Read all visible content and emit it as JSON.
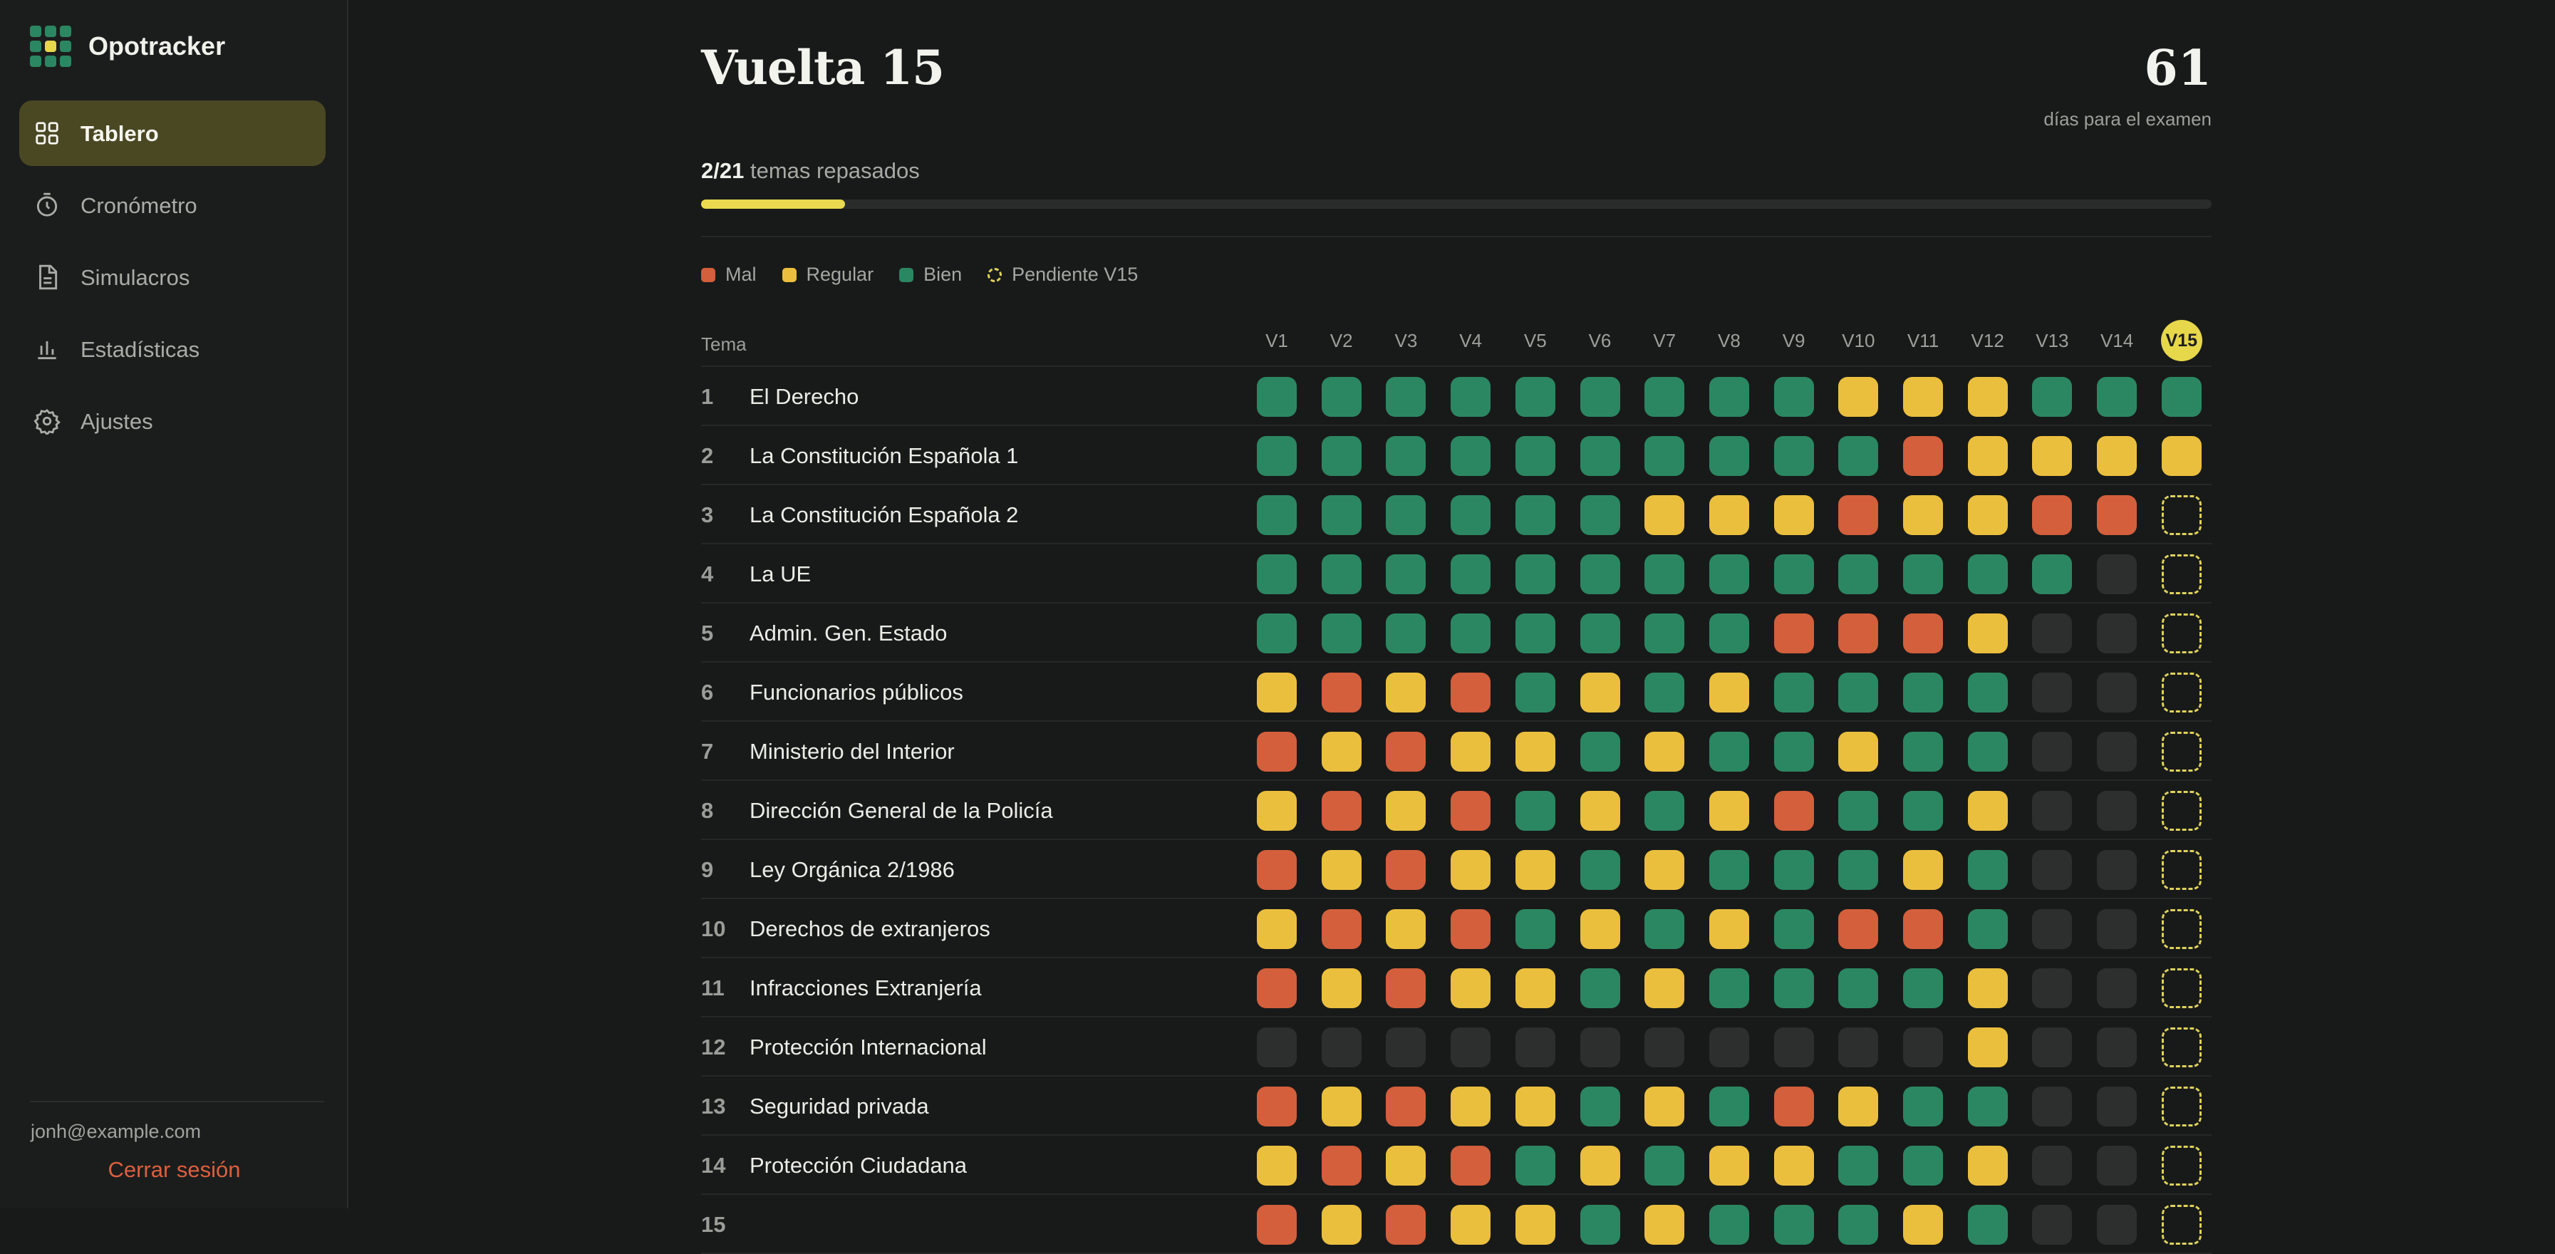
{
  "brand": {
    "name": "Opotracker"
  },
  "nav": [
    {
      "label": "Tablero",
      "icon": "dashboard-icon",
      "active": true
    },
    {
      "label": "Cronómetro",
      "icon": "timer-icon",
      "active": false
    },
    {
      "label": "Simulacros",
      "icon": "document-icon",
      "active": false
    },
    {
      "label": "Estadísticas",
      "icon": "bar-chart-icon",
      "active": false
    },
    {
      "label": "Ajustes",
      "icon": "gear-icon",
      "active": false
    }
  ],
  "user": {
    "email": "jonh@example.com",
    "logout": "Cerrar sesión"
  },
  "header": {
    "title": "Vuelta 15",
    "days": "61",
    "days_label": "días para el examen"
  },
  "progress": {
    "done": "2/21",
    "label": "temas repasados",
    "fraction": 0.0952
  },
  "legend": [
    {
      "label": "Mal",
      "code": "r"
    },
    {
      "label": "Regular",
      "code": "y"
    },
    {
      "label": "Bien",
      "code": "g"
    },
    {
      "label": "Pendiente V15",
      "code": "p"
    }
  ],
  "colors": {
    "bien": "#2b8762",
    "regular": "#ebbf3e",
    "mal": "#d35f3c",
    "accent": "#e6d74b",
    "empty": "#2c2f2d"
  },
  "table": {
    "tema_header": "Tema",
    "columns": [
      "V1",
      "V2",
      "V3",
      "V4",
      "V5",
      "V6",
      "V7",
      "V8",
      "V9",
      "V10",
      "V11",
      "V12",
      "V13",
      "V14",
      "V15"
    ],
    "current_column": "V15",
    "rows": [
      {
        "num": "1",
        "name": "El Derecho",
        "cells": [
          "g",
          "g",
          "g",
          "g",
          "g",
          "g",
          "g",
          "g",
          "g",
          "y",
          "y",
          "y",
          "g",
          "g",
          "g"
        ]
      },
      {
        "num": "2",
        "name": "La Constitución Española 1",
        "cells": [
          "g",
          "g",
          "g",
          "g",
          "g",
          "g",
          "g",
          "g",
          "g",
          "g",
          "r",
          "y",
          "y",
          "y",
          "y"
        ]
      },
      {
        "num": "3",
        "name": "La Constitución Española 2",
        "cells": [
          "g",
          "g",
          "g",
          "g",
          "g",
          "g",
          "y",
          "y",
          "y",
          "r",
          "y",
          "y",
          "r",
          "r",
          "p"
        ]
      },
      {
        "num": "4",
        "name": "La UE",
        "cells": [
          "g",
          "g",
          "g",
          "g",
          "g",
          "g",
          "g",
          "g",
          "g",
          "g",
          "g",
          "g",
          "g",
          "e",
          "p"
        ]
      },
      {
        "num": "5",
        "name": "Admin. Gen. Estado",
        "cells": [
          "g",
          "g",
          "g",
          "g",
          "g",
          "g",
          "g",
          "g",
          "r",
          "r",
          "r",
          "y",
          "e",
          "e",
          "p"
        ]
      },
      {
        "num": "6",
        "name": "Funcionarios públicos",
        "cells": [
          "y",
          "r",
          "y",
          "r",
          "g",
          "y",
          "g",
          "y",
          "g",
          "g",
          "g",
          "g",
          "e",
          "e",
          "p"
        ]
      },
      {
        "num": "7",
        "name": "Ministerio del Interior",
        "cells": [
          "r",
          "y",
          "r",
          "y",
          "y",
          "g",
          "y",
          "g",
          "g",
          "y",
          "g",
          "g",
          "e",
          "e",
          "p"
        ]
      },
      {
        "num": "8",
        "name": "Dirección General de la Policía",
        "cells": [
          "y",
          "r",
          "y",
          "r",
          "g",
          "y",
          "g",
          "y",
          "r",
          "g",
          "g",
          "y",
          "e",
          "e",
          "p"
        ]
      },
      {
        "num": "9",
        "name": "Ley Orgánica 2/1986",
        "cells": [
          "r",
          "y",
          "r",
          "y",
          "y",
          "g",
          "y",
          "g",
          "g",
          "g",
          "y",
          "g",
          "e",
          "e",
          "p"
        ]
      },
      {
        "num": "10",
        "name": "Derechos de extranjeros",
        "cells": [
          "y",
          "r",
          "y",
          "r",
          "g",
          "y",
          "g",
          "y",
          "g",
          "r",
          "r",
          "g",
          "e",
          "e",
          "p"
        ]
      },
      {
        "num": "11",
        "name": "Infracciones Extranjería",
        "cells": [
          "r",
          "y",
          "r",
          "y",
          "y",
          "g",
          "y",
          "g",
          "g",
          "g",
          "g",
          "y",
          "e",
          "e",
          "p"
        ]
      },
      {
        "num": "12",
        "name": "Protección Internacional",
        "cells": [
          "e",
          "e",
          "e",
          "e",
          "e",
          "e",
          "e",
          "e",
          "e",
          "e",
          "e",
          "y",
          "e",
          "e",
          "p"
        ]
      },
      {
        "num": "13",
        "name": "Seguridad privada",
        "cells": [
          "r",
          "y",
          "r",
          "y",
          "y",
          "g",
          "y",
          "g",
          "r",
          "y",
          "g",
          "g",
          "e",
          "e",
          "p"
        ]
      },
      {
        "num": "14",
        "name": "Protección Ciudadana",
        "cells": [
          "y",
          "r",
          "y",
          "r",
          "g",
          "y",
          "g",
          "y",
          "y",
          "g",
          "g",
          "y",
          "e",
          "e",
          "p"
        ]
      },
      {
        "num": "15",
        "name": "",
        "cells": [
          "r",
          "y",
          "r",
          "y",
          "y",
          "g",
          "y",
          "g",
          "g",
          "g",
          "y",
          "g",
          "e",
          "e",
          "p"
        ]
      }
    ]
  }
}
